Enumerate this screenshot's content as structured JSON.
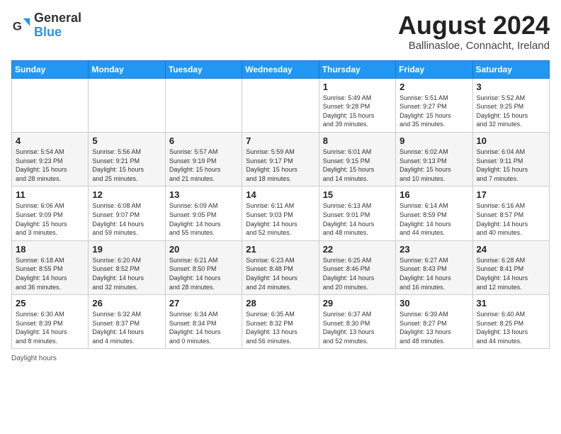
{
  "header": {
    "logo_general": "General",
    "logo_blue": "Blue",
    "month_title": "August 2024",
    "location": "Ballinasloe, Connacht, Ireland"
  },
  "days_of_week": [
    "Sunday",
    "Monday",
    "Tuesday",
    "Wednesday",
    "Thursday",
    "Friday",
    "Saturday"
  ],
  "footer": {
    "note": "Daylight hours"
  },
  "weeks": [
    [
      {
        "day": "",
        "info": ""
      },
      {
        "day": "",
        "info": ""
      },
      {
        "day": "",
        "info": ""
      },
      {
        "day": "",
        "info": ""
      },
      {
        "day": "1",
        "info": "Sunrise: 5:49 AM\nSunset: 9:28 PM\nDaylight: 15 hours\nand 39 minutes."
      },
      {
        "day": "2",
        "info": "Sunrise: 5:51 AM\nSunset: 9:27 PM\nDaylight: 15 hours\nand 35 minutes."
      },
      {
        "day": "3",
        "info": "Sunrise: 5:52 AM\nSunset: 9:25 PM\nDaylight: 15 hours\nand 32 minutes."
      }
    ],
    [
      {
        "day": "4",
        "info": "Sunrise: 5:54 AM\nSunset: 9:23 PM\nDaylight: 15 hours\nand 28 minutes."
      },
      {
        "day": "5",
        "info": "Sunrise: 5:56 AM\nSunset: 9:21 PM\nDaylight: 15 hours\nand 25 minutes."
      },
      {
        "day": "6",
        "info": "Sunrise: 5:57 AM\nSunset: 9:19 PM\nDaylight: 15 hours\nand 21 minutes."
      },
      {
        "day": "7",
        "info": "Sunrise: 5:59 AM\nSunset: 9:17 PM\nDaylight: 15 hours\nand 18 minutes."
      },
      {
        "day": "8",
        "info": "Sunrise: 6:01 AM\nSunset: 9:15 PM\nDaylight: 15 hours\nand 14 minutes."
      },
      {
        "day": "9",
        "info": "Sunrise: 6:02 AM\nSunset: 9:13 PM\nDaylight: 15 hours\nand 10 minutes."
      },
      {
        "day": "10",
        "info": "Sunrise: 6:04 AM\nSunset: 9:11 PM\nDaylight: 15 hours\nand 7 minutes."
      }
    ],
    [
      {
        "day": "11",
        "info": "Sunrise: 6:06 AM\nSunset: 9:09 PM\nDaylight: 15 hours\nand 3 minutes."
      },
      {
        "day": "12",
        "info": "Sunrise: 6:08 AM\nSunset: 9:07 PM\nDaylight: 14 hours\nand 59 minutes."
      },
      {
        "day": "13",
        "info": "Sunrise: 6:09 AM\nSunset: 9:05 PM\nDaylight: 14 hours\nand 55 minutes."
      },
      {
        "day": "14",
        "info": "Sunrise: 6:11 AM\nSunset: 9:03 PM\nDaylight: 14 hours\nand 52 minutes."
      },
      {
        "day": "15",
        "info": "Sunrise: 6:13 AM\nSunset: 9:01 PM\nDaylight: 14 hours\nand 48 minutes."
      },
      {
        "day": "16",
        "info": "Sunrise: 6:14 AM\nSunset: 8:59 PM\nDaylight: 14 hours\nand 44 minutes."
      },
      {
        "day": "17",
        "info": "Sunrise: 6:16 AM\nSunset: 8:57 PM\nDaylight: 14 hours\nand 40 minutes."
      }
    ],
    [
      {
        "day": "18",
        "info": "Sunrise: 6:18 AM\nSunset: 8:55 PM\nDaylight: 14 hours\nand 36 minutes."
      },
      {
        "day": "19",
        "info": "Sunrise: 6:20 AM\nSunset: 8:52 PM\nDaylight: 14 hours\nand 32 minutes."
      },
      {
        "day": "20",
        "info": "Sunrise: 6:21 AM\nSunset: 8:50 PM\nDaylight: 14 hours\nand 28 minutes."
      },
      {
        "day": "21",
        "info": "Sunrise: 6:23 AM\nSunset: 8:48 PM\nDaylight: 14 hours\nand 24 minutes."
      },
      {
        "day": "22",
        "info": "Sunrise: 6:25 AM\nSunset: 8:46 PM\nDaylight: 14 hours\nand 20 minutes."
      },
      {
        "day": "23",
        "info": "Sunrise: 6:27 AM\nSunset: 8:43 PM\nDaylight: 14 hours\nand 16 minutes."
      },
      {
        "day": "24",
        "info": "Sunrise: 6:28 AM\nSunset: 8:41 PM\nDaylight: 14 hours\nand 12 minutes."
      }
    ],
    [
      {
        "day": "25",
        "info": "Sunrise: 6:30 AM\nSunset: 8:39 PM\nDaylight: 14 hours\nand 8 minutes."
      },
      {
        "day": "26",
        "info": "Sunrise: 6:32 AM\nSunset: 8:37 PM\nDaylight: 14 hours\nand 4 minutes."
      },
      {
        "day": "27",
        "info": "Sunrise: 6:34 AM\nSunset: 8:34 PM\nDaylight: 14 hours\nand 0 minutes."
      },
      {
        "day": "28",
        "info": "Sunrise: 6:35 AM\nSunset: 8:32 PM\nDaylight: 13 hours\nand 56 minutes."
      },
      {
        "day": "29",
        "info": "Sunrise: 6:37 AM\nSunset: 8:30 PM\nDaylight: 13 hours\nand 52 minutes."
      },
      {
        "day": "30",
        "info": "Sunrise: 6:39 AM\nSunset: 8:27 PM\nDaylight: 13 hours\nand 48 minutes."
      },
      {
        "day": "31",
        "info": "Sunrise: 6:40 AM\nSunset: 8:25 PM\nDaylight: 13 hours\nand 44 minutes."
      }
    ]
  ]
}
